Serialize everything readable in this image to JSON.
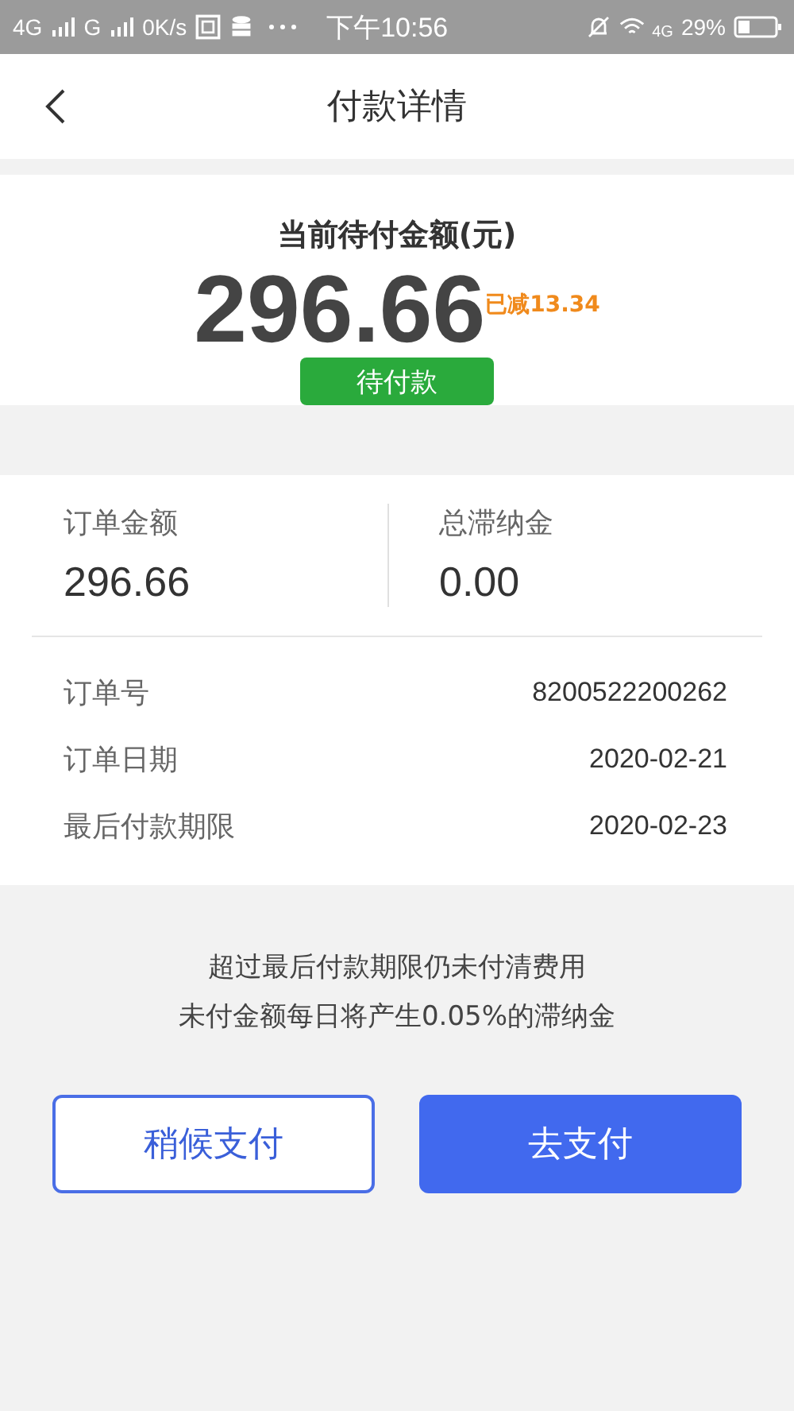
{
  "status_bar": {
    "network_1": "4G",
    "network_2": "G",
    "speed": "0K/s",
    "time": "下午10:56",
    "network_3": "4G",
    "battery": "29%"
  },
  "header": {
    "title": "付款详情"
  },
  "summary": {
    "label": "当前待付金额(元)",
    "amount": "296.66",
    "discount": "已减13.34",
    "status": "待付款"
  },
  "totals": [
    {
      "label": "订单金额",
      "value": "296.66"
    },
    {
      "label": "总滞纳金",
      "value": "0.00"
    }
  ],
  "details": [
    {
      "label": "订单号",
      "value": "8200522200262"
    },
    {
      "label": "订单日期",
      "value": "2020-02-21"
    },
    {
      "label": "最后付款期限",
      "value": "2020-02-23"
    }
  ],
  "notice": [
    "超过最后付款期限仍未付清费用",
    "未付金额每日将产生0.05%的滞纳金"
  ],
  "buttons": [
    {
      "label": "稍候支付",
      "kind": "outline"
    },
    {
      "label": "去支付",
      "kind": "primary"
    }
  ]
}
